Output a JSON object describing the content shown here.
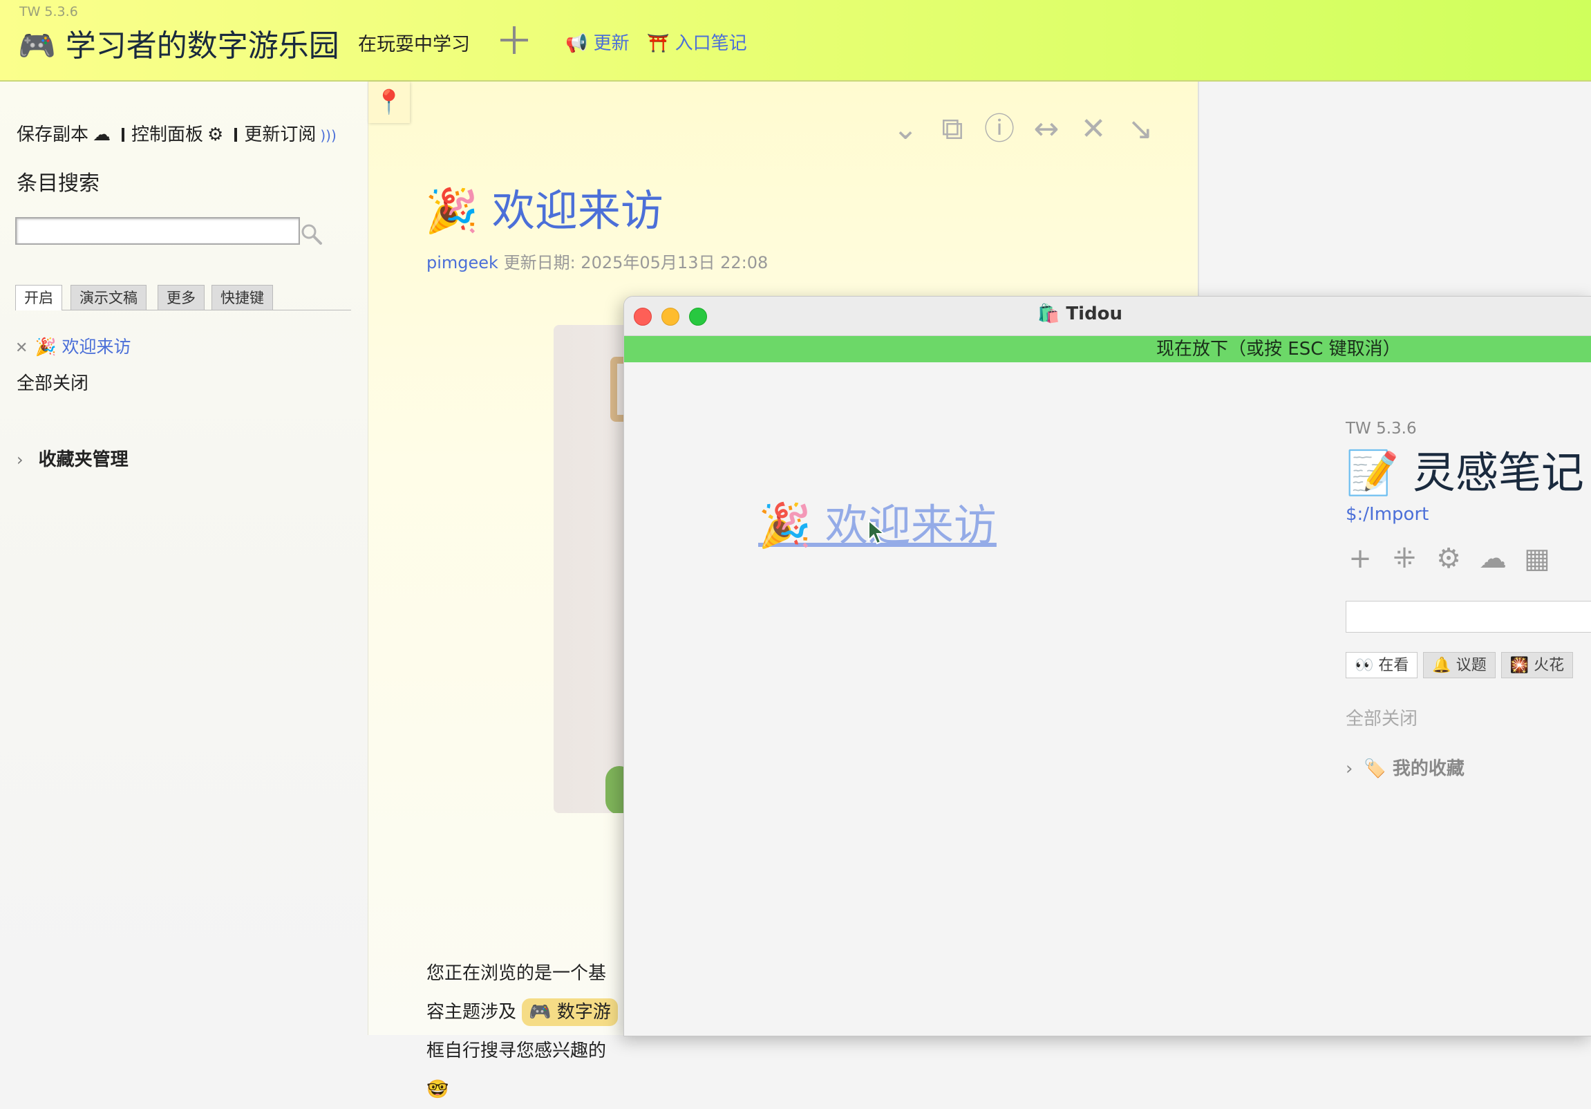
{
  "topbar": {
    "version": "TW 5.3.6",
    "title": "🎮 学习者的数字游乐园",
    "subtitle": "在玩耍中学习",
    "links": [
      "📢 更新",
      "⛩️ 入口笔记"
    ]
  },
  "sidebar": {
    "actions": {
      "save": "保存副本",
      "control_panel": "控制面板",
      "update_feed": "更新订阅"
    },
    "search_heading": "条目搜索",
    "search_value": "",
    "tabs": [
      "开启",
      "演示文稿",
      "更多",
      "快捷键"
    ],
    "active_tab": "开启",
    "open_items": [
      "🎉 欢迎来访"
    ],
    "close_all": "全部关闭",
    "fav_manager": "收藏夹管理"
  },
  "tiddler": {
    "title": "🎉 欢迎来访",
    "author": "pimgeek",
    "modified": "更新日期: 2025年05月13日 22:08",
    "body_lines": [
      "您正在浏览的是一个基",
      "容主题涉及",
      "框自行搜寻您感兴趣的",
      "🤓"
    ],
    "tag_pill": "🎮 数字游"
  },
  "tidou": {
    "window_title": "🛍️ Tidou",
    "drop_message": "现在放下（或按 ESC 键取消）",
    "dragged_item": "🎉 欢迎来访",
    "inner": {
      "version": "TW 5.3.6",
      "title": "📝 灵感笔记",
      "link": "$:/Import",
      "tabs": [
        "👀 在看",
        "🔔 议题",
        "🎇 火花"
      ],
      "close_all": "全部关闭",
      "fav": "🏷️ 我的收藏"
    }
  },
  "colors": {
    "accent": "#4b6fd8",
    "topbar_start": "#fbff8c",
    "topbar_end": "#cfff5c",
    "drop_bar": "#6cd868"
  }
}
